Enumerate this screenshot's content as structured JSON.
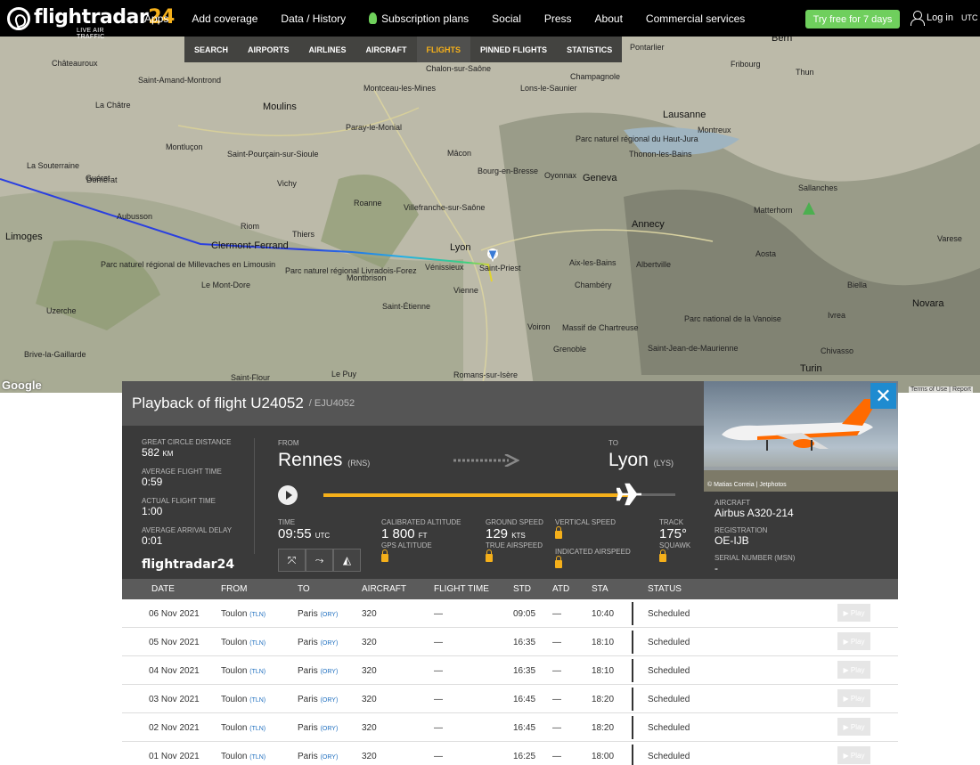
{
  "brand": {
    "name_a": "flightradar",
    "name_b": "24",
    "tagline": "LIVE AIR TRAFFIC"
  },
  "nav": [
    "Apps",
    "Add coverage",
    "Data / History",
    "Subscription plans",
    "Social",
    "Press",
    "About",
    "Commercial services"
  ],
  "try_button": "Try free for 7 days",
  "login": "Log in",
  "utc": "UTC",
  "subnav": [
    "SEARCH",
    "AIRPORTS",
    "AIRLINES",
    "AIRCRAFT",
    "FLIGHTS",
    "PINNED FLIGHTS",
    "STATISTICS"
  ],
  "map_labels": [
    "Châteauroux",
    "Saint-Amand-Montrond",
    "Moulins",
    "Montceau-les-Mines",
    "Chalon-sur-Saône",
    "Lons-le-Saunier",
    "Champagnole",
    "Pontarlier",
    "Fribourg",
    "Thun",
    "Bern",
    "Montluçon",
    "Vichy",
    "Mâcon",
    "Bourg-en-Bresse",
    "Oyonnax",
    "Geneva",
    "Lausanne",
    "Montreux",
    "Thonon-les-Bains",
    "Roanne",
    "Villefranche-sur-Saône",
    "Annecy",
    "Clermont-Ferrand",
    "Riom",
    "Thiers",
    "Lyon",
    "Vénissieux",
    "Saint-Priest",
    "Aix-les-Bains",
    "Albertville",
    "Chambéry",
    "Vienne",
    "Saint-Étienne",
    "Grenoble",
    "Turin",
    "Novara",
    "Biella",
    "Aosta",
    "Ivrea",
    "Limoges",
    "Aubusson",
    "Le Puy",
    "Romans-sur-Isère",
    "Brive-la-Gaillarde",
    "Matterhorn",
    "Chivasso",
    "Varese",
    "Domérat",
    "Paray-le-Monial",
    "Parc naturel régional du Haut-Jura",
    "Parc naturel régional Livradois-Forez",
    "Parc naturel régional de Millevaches en Limousin",
    "Parc national de la Vanoise",
    "Massif de Chartreuse",
    "Saint-Pourçain-sur-Sioule",
    "Montbrison",
    "Voiron",
    "Saint-Flour",
    "Le Mont-Dore",
    "La Souterraine",
    "Guéret",
    "Uzerche",
    "La Châtre",
    "Sallanches",
    "Saint-Jean-de-Maurienne",
    "Terms of Use",
    "Report"
  ],
  "google": "Google",
  "panel": {
    "title": "Playback of flight U24052",
    "subtitle": "/ EJU4052",
    "close": "✕",
    "photo_credit": "© Matias Correia | Jetphotos",
    "stats": [
      {
        "label": "GREAT CIRCLE DISTANCE",
        "value": "582",
        "unit": "KM"
      },
      {
        "label": "AVERAGE FLIGHT TIME",
        "value": "0:59",
        "unit": ""
      },
      {
        "label": "ACTUAL FLIGHT TIME",
        "value": "1:00",
        "unit": ""
      },
      {
        "label": "AVERAGE ARRIVAL DELAY",
        "value": "0:01",
        "unit": ""
      }
    ],
    "from_label": "FROM",
    "to_label": "TO",
    "from_city": "Rennes",
    "from_code": "(RNS)",
    "to_city": "Lyon",
    "to_code": "(LYS)",
    "progress": 0.87,
    "time_label": "TIME",
    "time_value": "09:55",
    "time_unit": "UTC",
    "cal_alt_label": "CALIBRATED ALTITUDE",
    "cal_alt_value": "1 800",
    "cal_alt_unit": "FT",
    "gps_alt_label": "GPS ALTITUDE",
    "ground_speed_label": "GROUND SPEED",
    "ground_speed_value": "129",
    "ground_speed_unit": "KTS",
    "true_airspeed_label": "TRUE AIRSPEED",
    "vertical_speed_label": "VERTICAL SPEED",
    "indicated_airspeed_label": "INDICATED AIRSPEED",
    "track_label": "TRACK",
    "track_value": "175°",
    "squawk_label": "SQUAWK",
    "aircraft_label": "AIRCRAFT",
    "aircraft_value": "Airbus A320-214",
    "registration_label": "REGISTRATION",
    "registration_value": "OE-IJB",
    "msn_label": "SERIAL NUMBER (MSN)",
    "msn_value": "-"
  },
  "table": {
    "headers": [
      "DATE",
      "FROM",
      "TO",
      "AIRCRAFT",
      "FLIGHT TIME",
      "STD",
      "ATD",
      "STA",
      "STATUS"
    ],
    "play_label": "▶ Play",
    "rows": [
      {
        "date": "06 Nov 2021",
        "from": "Toulon",
        "from_code": "(TLN)",
        "to": "Paris",
        "to_code": "(ORY)",
        "aircraft": "320",
        "flight_time": "—",
        "std": "09:05",
        "atd": "—",
        "sta": "10:40",
        "status": "Scheduled"
      },
      {
        "date": "05 Nov 2021",
        "from": "Toulon",
        "from_code": "(TLN)",
        "to": "Paris",
        "to_code": "(ORY)",
        "aircraft": "320",
        "flight_time": "—",
        "std": "16:35",
        "atd": "—",
        "sta": "18:10",
        "status": "Scheduled"
      },
      {
        "date": "04 Nov 2021",
        "from": "Toulon",
        "from_code": "(TLN)",
        "to": "Paris",
        "to_code": "(ORY)",
        "aircraft": "320",
        "flight_time": "—",
        "std": "16:35",
        "atd": "—",
        "sta": "18:10",
        "status": "Scheduled"
      },
      {
        "date": "03 Nov 2021",
        "from": "Toulon",
        "from_code": "(TLN)",
        "to": "Paris",
        "to_code": "(ORY)",
        "aircraft": "320",
        "flight_time": "—",
        "std": "16:45",
        "atd": "—",
        "sta": "18:20",
        "status": "Scheduled"
      },
      {
        "date": "02 Nov 2021",
        "from": "Toulon",
        "from_code": "(TLN)",
        "to": "Paris",
        "to_code": "(ORY)",
        "aircraft": "320",
        "flight_time": "—",
        "std": "16:45",
        "atd": "—",
        "sta": "18:20",
        "status": "Scheduled"
      },
      {
        "date": "01 Nov 2021",
        "from": "Toulon",
        "from_code": "(TLN)",
        "to": "Paris",
        "to_code": "(ORY)",
        "aircraft": "320",
        "flight_time": "—",
        "std": "16:25",
        "atd": "—",
        "sta": "18:00",
        "status": "Scheduled"
      }
    ]
  },
  "colors": {
    "accent": "#f5b01a",
    "green": "#6fcf5d",
    "blue": "#1f8bd0",
    "track_blue": "#2a3fe0",
    "track_green": "#3ed17a"
  }
}
